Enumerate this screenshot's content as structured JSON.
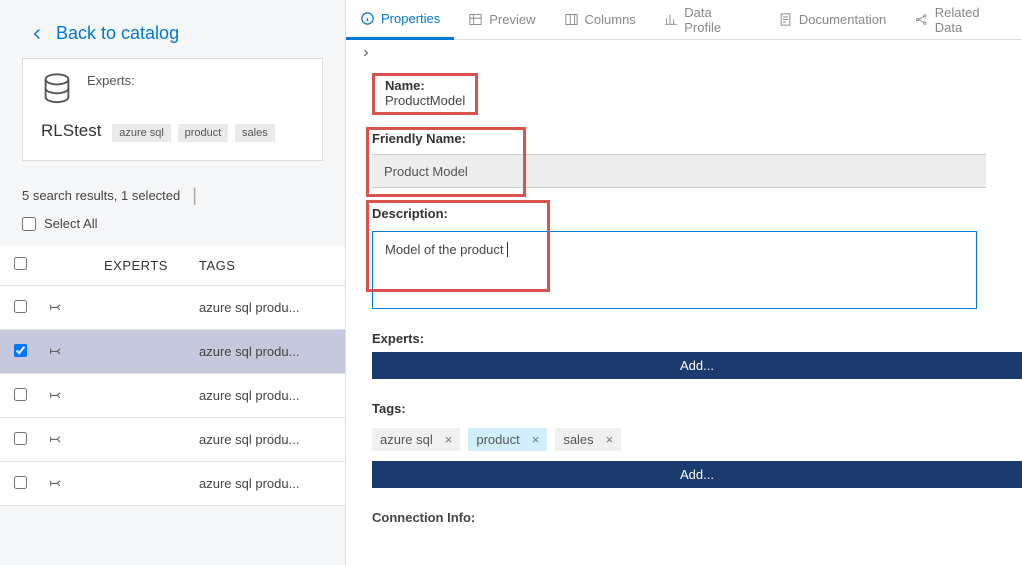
{
  "back_link": "Back to catalog",
  "card": {
    "experts_label": "Experts:",
    "name": "RLStest",
    "tags": [
      "azure sql",
      "product",
      "sales"
    ]
  },
  "results_text": "5 search results, 1 selected",
  "select_all": "Select All",
  "table": {
    "headers": {
      "experts": "EXPERTS",
      "tags": "TAGS"
    },
    "rows": [
      {
        "selected": false,
        "tags": "azure sql produ..."
      },
      {
        "selected": true,
        "tags": "azure sql produ..."
      },
      {
        "selected": false,
        "tags": "azure sql produ..."
      },
      {
        "selected": false,
        "tags": "azure sql produ..."
      },
      {
        "selected": false,
        "tags": "azure sql produ..."
      }
    ]
  },
  "tabs": {
    "properties": "Properties",
    "preview": "Preview",
    "columns": "Columns",
    "data_profile": "Data Profile",
    "documentation": "Documentation",
    "related_data": "Related Data"
  },
  "properties": {
    "name_label": "Name:",
    "name_value": "ProductModel",
    "friendly_label": "Friendly Name:",
    "friendly_value": "Product Model",
    "description_label": "Description:",
    "description_value": "Model of the product",
    "experts_label": "Experts:",
    "tags_label": "Tags:",
    "tags": [
      "azure sql",
      "product",
      "sales"
    ],
    "add_label": "Add...",
    "connection_label": "Connection Info:"
  }
}
